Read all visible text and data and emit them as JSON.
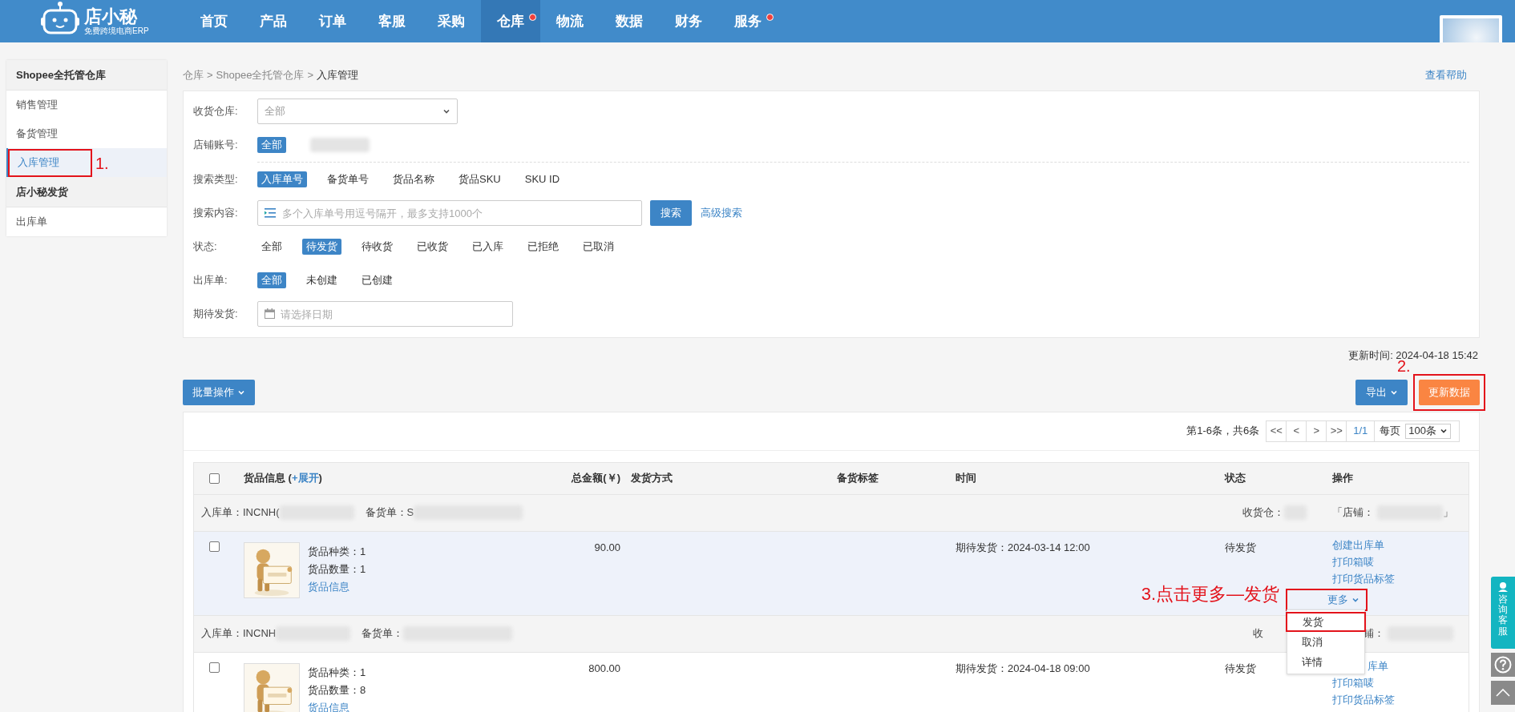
{
  "brand": {
    "name": "店小秘",
    "tagline": "免费跨境电商ERP"
  },
  "nav": [
    {
      "label": "首页",
      "selected": false,
      "badge": false
    },
    {
      "label": "产品",
      "selected": false,
      "badge": false
    },
    {
      "label": "订单",
      "selected": false,
      "badge": false
    },
    {
      "label": "客服",
      "selected": false,
      "badge": false
    },
    {
      "label": "采购",
      "selected": false,
      "badge": false
    },
    {
      "label": "仓库",
      "selected": true,
      "badge": true
    },
    {
      "label": "物流",
      "selected": false,
      "badge": false
    },
    {
      "label": "数据",
      "selected": false,
      "badge": false
    },
    {
      "label": "财务",
      "selected": false,
      "badge": false
    },
    {
      "label": "服务",
      "selected": false,
      "badge": true
    }
  ],
  "sidebar": [
    {
      "title": "Shopee全托管仓库",
      "items": [
        {
          "label": "销售管理",
          "selected": false
        },
        {
          "label": "备货管理",
          "selected": false
        },
        {
          "label": "入库管理",
          "selected": true
        }
      ]
    },
    {
      "title": "店小秘发货",
      "items": [
        {
          "label": "出库单",
          "selected": false
        }
      ]
    }
  ],
  "breadcrumb": [
    "仓库",
    "Shopee全托管仓库",
    "入库管理"
  ],
  "breadcrumb_separator": ">",
  "help_link": "查看帮助",
  "filters": [
    {
      "kind": "select",
      "label": "收货仓库:",
      "value": "全部"
    },
    {
      "kind": "chips",
      "label": "店铺账号:",
      "blurred": true,
      "options": [
        {
          "label": "全部",
          "selected": true
        }
      ]
    },
    {
      "kind": "chips",
      "label": "搜索类型:",
      "divider": true,
      "options": [
        {
          "label": "入库单号",
          "selected": true
        },
        {
          "label": "备货单号",
          "selected": false
        },
        {
          "label": "货品名称",
          "selected": false
        },
        {
          "label": "货品SKU",
          "selected": false
        },
        {
          "label": "SKU ID",
          "selected": false
        }
      ]
    },
    {
      "kind": "search",
      "label": "搜索内容:",
      "placeholder": "多个入库单号用逗号隔开，最多支持1000个",
      "button": "搜索",
      "link": "高级搜索"
    },
    {
      "kind": "chips",
      "label": "状态:",
      "options": [
        {
          "label": "全部",
          "selected": false
        },
        {
          "label": "待发货",
          "selected": true
        },
        {
          "label": "待收货",
          "selected": false
        },
        {
          "label": "已收货",
          "selected": false
        },
        {
          "label": "已入库",
          "selected": false
        },
        {
          "label": "已拒绝",
          "selected": false
        },
        {
          "label": "已取消",
          "selected": false
        }
      ]
    },
    {
      "kind": "chips",
      "label": "出库单:",
      "options": [
        {
          "label": "全部",
          "selected": true
        },
        {
          "label": "未创建",
          "selected": false
        },
        {
          "label": "已创建",
          "selected": false
        }
      ]
    },
    {
      "kind": "date",
      "label": "期待发货:",
      "placeholder": "请选择日期"
    }
  ],
  "updated": "更新时间: 2024-04-18 15:42",
  "batch_button": "批量操作",
  "export_button": "导出",
  "refresh_button": "更新数据",
  "pagination": {
    "summary": "第1-6条，共6条",
    "buttons": [
      "<<",
      "<",
      ">",
      ">>"
    ],
    "page": "1/1",
    "per_page_label": "每页",
    "per_page": "100条"
  },
  "table": {
    "select_all_checked": false,
    "columns": [
      {
        "label": "货品信息 (",
        "link": "+展开",
        "after": ")"
      },
      {
        "label": "总金额(￥)"
      },
      {
        "label": "发货方式"
      },
      {
        "label": "备货标签"
      },
      {
        "label": "时间"
      },
      {
        "label": "状态"
      },
      {
        "label": "操作"
      }
    ],
    "orders": [
      {
        "inbound_label": "入库单：",
        "inbound": "INCNH(",
        "stock_label": "备货单：",
        "stock": "S",
        "warehouse_label": "收货仓：",
        "warehouse_blurred": true,
        "shop_label": "「店铺：",
        "shop_close": "」",
        "checked": false,
        "highlighted": true,
        "kinds": "货品种类：1",
        "qty": "货品数量：1",
        "info_link": "货品信息",
        "amount": "90.00",
        "time": "期待发货：2024-03-14 12:00",
        "status": "待发货",
        "actions": [
          "创建出库单",
          "打印箱唛",
          "打印货品标签"
        ],
        "more": "更多",
        "menu": [
          {
            "label": "发货",
            "selected": true
          },
          {
            "label": "取消",
            "selected": false
          },
          {
            "label": "详情",
            "selected": false
          }
        ]
      },
      {
        "inbound_label": "入库单：",
        "inbound": "INCNH",
        "stock_label": "备货单：",
        "warehouse_label": "收",
        "warehouse_blurred": false,
        "shop_label": "铺：",
        "checked": false,
        "highlighted": false,
        "kinds": "货品种类：1",
        "qty": "货品数量：8",
        "info_link": "货品信息",
        "amount": "800.00",
        "time": "期待发货：2024-04-18 09:00",
        "status": "待发货",
        "actions": [
          "库单",
          "打印箱唛",
          "打印货品标签"
        ]
      }
    ]
  },
  "annotations": [
    "1.",
    "2.",
    "3.点击更多—发货"
  ],
  "float": {
    "consult": "咨询客服"
  }
}
